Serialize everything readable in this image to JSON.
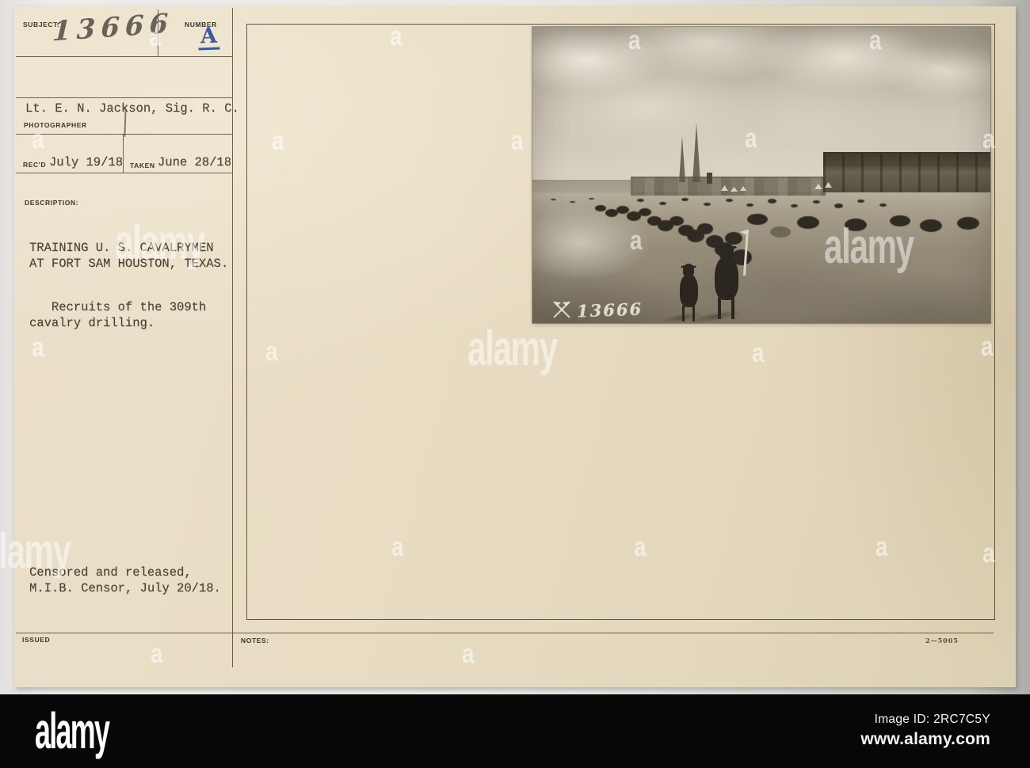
{
  "card": {
    "subject": {
      "label": "SUBJECT:",
      "value": "13666"
    },
    "number": {
      "label": "NUMBER",
      "value": "A"
    },
    "photographer": {
      "value": "Lt. E. N. Jackson, Sig. R. C.",
      "label": "PHOTOGRAPHER"
    },
    "received": {
      "label": "REC'D",
      "value": "July 19/18"
    },
    "taken": {
      "label": "TAKEN",
      "value": "June 28/18"
    },
    "description": {
      "label": "DESCRIPTION:",
      "title": "TRAINING U. S. CAVALRYMEN\nAT FORT SAM HOUSTON, TEXAS.",
      "detail": "   Recruits of the 309th\ncavalry drilling."
    },
    "censor": {
      "value": "Censored and released,\nM.I.B. Censor, July 20/18."
    },
    "issued": {
      "label": "ISSUED"
    },
    "notes": {
      "label": "NOTES:"
    },
    "print_code": "2—5005"
  },
  "photo": {
    "marking": "13666",
    "marking_icon": "signal-corps-crossed-flags"
  },
  "watermark": {
    "small": "a",
    "large": "alamy"
  },
  "footer": {
    "logo": "alamy",
    "image_id": "Image ID: 2RC7C5Y",
    "url": "www.alamy.com"
  },
  "colors": {
    "card": "#e7dcc2",
    "typed_ink": "#4a4034",
    "label_ink": "#3b362d",
    "stamp_blue": "#2e4e9e",
    "rule_line": "#4a4336",
    "bar": "#070707",
    "watermark": "#ffffff"
  }
}
